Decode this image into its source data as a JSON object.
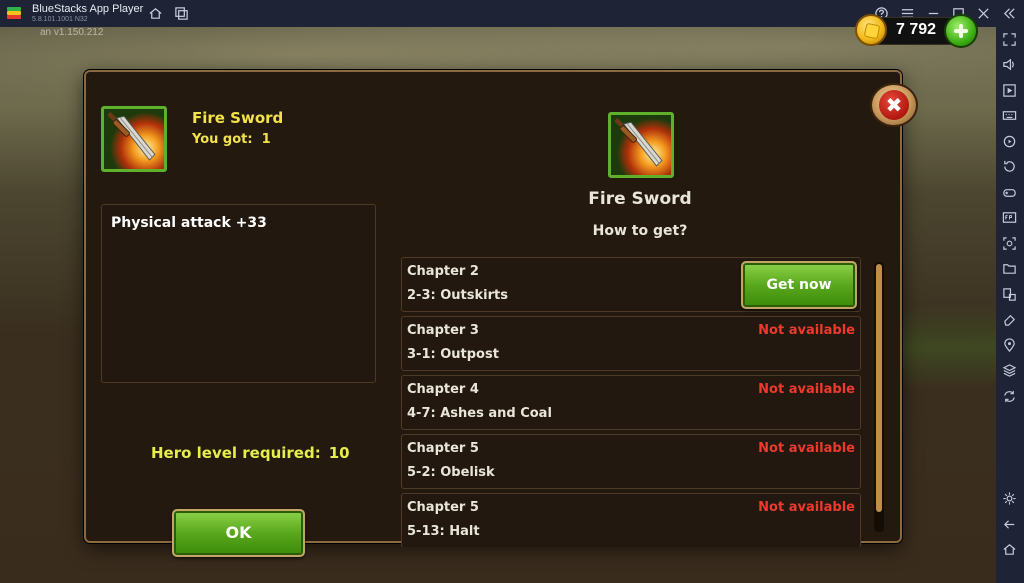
{
  "window": {
    "title": "BlueStacks App Player",
    "version": "5.8.101.1001 N32",
    "app_version": "an v1.150.212"
  },
  "currency": {
    "coins": "7 792"
  },
  "dialog": {
    "item_name": "Fire Sword",
    "you_got_label": "You got:",
    "you_got_value": "1",
    "stat": "Physical attack +33",
    "hero_level_label": "Hero level required:",
    "hero_level_value": "10",
    "ok_label": "OK",
    "right_title": "Fire Sword",
    "how_to_get": "How to get?",
    "sources": [
      {
        "chapter": "Chapter 2",
        "stage": "2-3: Outskirts",
        "action": "Get now"
      },
      {
        "chapter": "Chapter 3",
        "stage": "3-1: Outpost",
        "status": "Not available"
      },
      {
        "chapter": "Chapter 4",
        "stage": "4-7: Ashes and Coal",
        "status": "Not available"
      },
      {
        "chapter": "Chapter 5",
        "stage": "5-2: Obelisk",
        "status": "Not available"
      },
      {
        "chapter": "Chapter 5",
        "stage": "5-13: Halt",
        "status": "Not available"
      }
    ]
  },
  "icons": {
    "titlebar": [
      "home-icon",
      "multi-instance-icon",
      "help-icon",
      "menu-icon",
      "minimize-icon",
      "maximize-icon",
      "close-icon",
      "collapse-sidebar-icon"
    ],
    "sidebar": [
      "fullscreen-icon",
      "volume-icon",
      "media-icon",
      "keyboard-icon",
      "rotate-icon",
      "replay-icon",
      "gamepad-icon",
      "fps-icon",
      "screenshot-icon",
      "folder-icon",
      "resize-icon",
      "eraser-icon",
      "location-icon",
      "layers-icon",
      "sync-icon",
      "settings-icon",
      "back-icon",
      "home-icon"
    ]
  }
}
